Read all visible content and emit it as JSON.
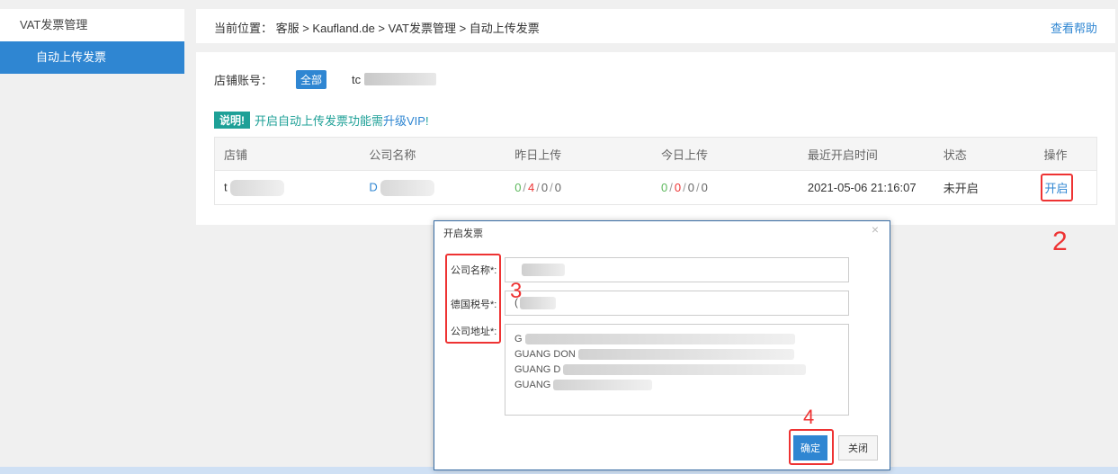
{
  "sidebar": {
    "title": "VAT发票管理",
    "active_item": "自动上传发票"
  },
  "topbar": {
    "breadcrumb": "当前位置： 客服 > Kaufland.de > VAT发票管理 > 自动上传发票",
    "help": "查看帮助"
  },
  "store_filter": {
    "label": "店铺账号：",
    "all": "全部",
    "store_prefix": "tc"
  },
  "notice": {
    "badge": "说明!",
    "text": "开启自动上传发票功能需",
    "link": "升级VIP",
    "suffix": "!"
  },
  "table": {
    "headers": [
      "店铺",
      "公司名称",
      "昨日上传",
      "今日上传",
      "最近开启时间",
      "状态",
      "操作"
    ],
    "row": {
      "store_prefix": "t",
      "company_prefix": "D",
      "yesterday": [
        "0",
        "4",
        "0",
        "0"
      ],
      "today": [
        "0",
        "0",
        "0",
        "0"
      ],
      "last_open": "2021-05-06 21:16:07",
      "status": "未开启",
      "action": "开启"
    }
  },
  "annotations": {
    "a2": "2",
    "a3": "3",
    "a4": "4"
  },
  "modal": {
    "title": "开启发票",
    "close_x": "×",
    "labels": {
      "company": "公司名称*:",
      "tax": "德国税号*:",
      "address": "公司地址*:"
    },
    "tax_prefix": "(",
    "address_lines": [
      "G",
      "GUANG DON",
      "GUANG D",
      "GUANG"
    ],
    "confirm": "确定",
    "close": "关闭"
  }
}
